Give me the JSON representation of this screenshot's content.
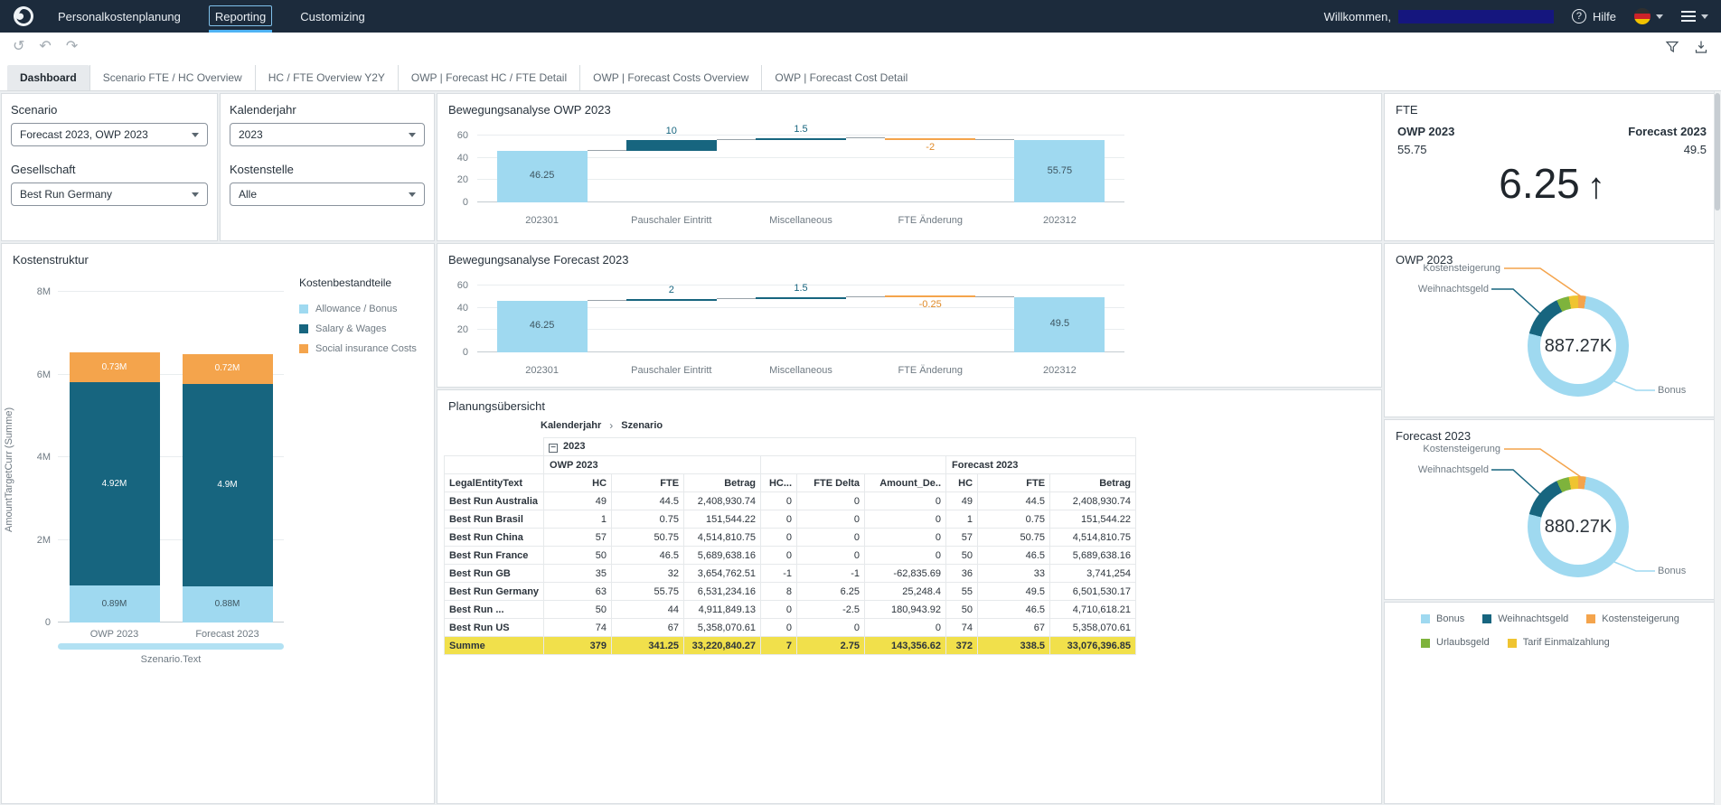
{
  "colors": {
    "light_blue": "#9FD9F0",
    "dark_blue": "#17657F",
    "orange": "#F4A44C",
    "green": "#7EB33C",
    "yellow": "#EFC431",
    "summe": "#F1E04B"
  },
  "navbar": {
    "items": [
      {
        "label": "Personalkostenplanung",
        "active": false
      },
      {
        "label": "Reporting",
        "active": true
      },
      {
        "label": "Customizing",
        "active": false
      }
    ],
    "welcome_label": "Willkommen,",
    "help_label": "Hilfe"
  },
  "toolbar": {
    "left_icons": [
      "reset",
      "undo",
      "redo"
    ],
    "right_icons": [
      "filter",
      "export"
    ]
  },
  "tabs": [
    {
      "label": "Dashboard",
      "active": true
    },
    {
      "label": "Scenario FTE / HC Overview",
      "active": false
    },
    {
      "label": "HC / FTE Overview Y2Y",
      "active": false
    },
    {
      "label": "OWP | Forecast HC / FTE Detail",
      "active": false
    },
    {
      "label": "OWP | Forecast Costs Overview",
      "active": false
    },
    {
      "label": "OWP | Forecast Cost Detail",
      "active": false
    }
  ],
  "filters": [
    {
      "label": "Scenario",
      "value": "Forecast 2023, OWP 2023"
    },
    {
      "label": "Kalenderjahr",
      "value": "2023"
    },
    {
      "label": "Gesellschaft",
      "value": "Best Run Germany"
    },
    {
      "label": "Kostenstelle",
      "value": "Alle"
    }
  ],
  "fte_card": {
    "title": "FTE",
    "left_label": "OWP 2023",
    "left_value": "55.75",
    "right_label": "Forecast 2023",
    "right_value": "49.5",
    "big_value": "6.25",
    "trend_arrow": "↑"
  },
  "chart_data": [
    {
      "type": "bar",
      "subtype": "waterfall",
      "title": "Bewegungsanalyse OWP 2023",
      "categories": [
        "202301",
        "Pauschaler Eintritt",
        "Miscellaneous",
        "FTE Änderung",
        "202312"
      ],
      "values": [
        46.25,
        10,
        1.5,
        -2,
        55.75
      ],
      "roles": [
        "total",
        "delta",
        "delta",
        "delta",
        "total"
      ],
      "ylim": [
        0,
        60
      ],
      "yticks": [
        0,
        20,
        40,
        60
      ],
      "grid": true,
      "legend_position": "none"
    },
    {
      "type": "bar",
      "subtype": "waterfall",
      "title": "Bewegungsanalyse Forecast 2023",
      "categories": [
        "202301",
        "Pauschaler Eintritt",
        "Miscellaneous",
        "FTE Änderung",
        "202312"
      ],
      "values": [
        46.25,
        2,
        1.5,
        -0.25,
        49.5
      ],
      "roles": [
        "total",
        "delta",
        "delta",
        "delta",
        "total"
      ],
      "ylim": [
        0,
        60
      ],
      "yticks": [
        0,
        20,
        40,
        60
      ],
      "grid": true,
      "legend_position": "none"
    },
    {
      "type": "bar",
      "subtype": "stacked",
      "title": "Kostenstruktur",
      "legend_title": "Kostenbestandteile",
      "categories": [
        "OWP 2023",
        "Forecast 2023"
      ],
      "series": [
        {
          "name": "Allowance / Bonus",
          "color": "light_blue",
          "values": [
            0.89,
            0.88
          ],
          "labels": [
            "0.89M",
            "0.88M"
          ]
        },
        {
          "name": "Salary & Wages",
          "color": "dark_blue",
          "values": [
            4.92,
            4.9
          ],
          "labels": [
            "4.92M",
            "4.9M"
          ]
        },
        {
          "name": "Social insurance Costs",
          "color": "orange",
          "values": [
            0.73,
            0.72
          ],
          "labels": [
            "0.73M",
            "0.72M"
          ]
        }
      ],
      "ylabel": "AmountTargetCurr (Summe)",
      "xlabel": "Szenario.Text",
      "unit": "M",
      "ylim": [
        0,
        8
      ],
      "yticks": [
        {
          "v": 0,
          "label": "0"
        },
        {
          "v": 2,
          "label": "2M"
        },
        {
          "v": 4,
          "label": "4M"
        },
        {
          "v": 6,
          "label": "6M"
        },
        {
          "v": 8,
          "label": "8M"
        }
      ],
      "grid": true,
      "legend_position": "right"
    },
    {
      "type": "pie",
      "title": "OWP 2023",
      "center_label": "887.27K",
      "slices": [
        {
          "name": "Kostensteigerung",
          "pct": 2.5,
          "color": "orange"
        },
        {
          "name": "Bonus",
          "pct": 76.5,
          "color": "light_blue"
        },
        {
          "name": "Weihnachtsgeld",
          "pct": 14,
          "color": "dark_blue"
        },
        {
          "name": "Urlaubsgeld",
          "pct": 4,
          "color": "green"
        },
        {
          "name": "Tarif Einmalzahlung",
          "pct": 3,
          "color": "yellow"
        }
      ],
      "callouts": [
        "Kostensteigerung",
        "Weihnachtsgeld",
        "Bonus"
      ]
    },
    {
      "type": "pie",
      "title": "Forecast 2023",
      "center_label": "880.27K",
      "slices": [
        {
          "name": "Kostensteigerung",
          "pct": 2.5,
          "color": "orange"
        },
        {
          "name": "Bonus",
          "pct": 76.5,
          "color": "light_blue"
        },
        {
          "name": "Weihnachtsgeld",
          "pct": 14,
          "color": "dark_blue"
        },
        {
          "name": "Urlaubsgeld",
          "pct": 4,
          "color": "green"
        },
        {
          "name": "Tarif Einmalzahlung",
          "pct": 3,
          "color": "yellow"
        }
      ],
      "callouts": [
        "Kostensteigerung",
        "Weihnachtsgeld",
        "Bonus"
      ]
    }
  ],
  "table": {
    "title": "Planungsübersicht",
    "drill_path": [
      "Kalenderjahr",
      "Szenario"
    ],
    "year_label": "2023",
    "group_headers": [
      "OWP 2023",
      "Forecast 2023"
    ],
    "columns": [
      "LegalEntityText",
      "HC",
      "FTE",
      "Betrag",
      "HC...",
      "FTE Delta",
      "Amount_De..",
      "HC",
      "FTE",
      "Betrag"
    ],
    "rows": [
      [
        "Best Run Australia",
        "49",
        "44.5",
        "2,408,930.74",
        "0",
        "0",
        "0",
        "49",
        "44.5",
        "2,408,930.74"
      ],
      [
        "Best Run Brasil",
        "1",
        "0.75",
        "151,544.22",
        "0",
        "0",
        "0",
        "1",
        "0.75",
        "151,544.22"
      ],
      [
        "Best Run China",
        "57",
        "50.75",
        "4,514,810.75",
        "0",
        "0",
        "0",
        "57",
        "50.75",
        "4,514,810.75"
      ],
      [
        "Best Run France",
        "50",
        "46.5",
        "5,689,638.16",
        "0",
        "0",
        "0",
        "50",
        "46.5",
        "5,689,638.16"
      ],
      [
        "Best Run GB",
        "35",
        "32",
        "3,654,762.51",
        "-1",
        "-1",
        "-62,835.69",
        "36",
        "33",
        "3,741,254"
      ],
      [
        "Best Run Germany",
        "63",
        "55.75",
        "6,531,234.16",
        "8",
        "6.25",
        "25,248.4",
        "55",
        "49.5",
        "6,501,530.17"
      ],
      [
        "Best Run ...",
        "50",
        "44",
        "4,911,849.13",
        "0",
        "-2.5",
        "180,943.92",
        "50",
        "46.5",
        "4,710,618.21"
      ],
      [
        "Best Run US",
        "74",
        "67",
        "5,358,070.61",
        "0",
        "0",
        "0",
        "74",
        "67",
        "5,358,070.61"
      ],
      [
        "Summe",
        "379",
        "341.25",
        "33,220,840.27",
        "7",
        "2.75",
        "143,356.62",
        "372",
        "338.5",
        "33,076,396.85"
      ]
    ]
  },
  "legend": {
    "items": [
      {
        "label": "Bonus",
        "color": "light_blue"
      },
      {
        "label": "Weihnachtsgeld",
        "color": "dark_blue"
      },
      {
        "label": "Kostensteigerung",
        "color": "orange"
      },
      {
        "label": "Urlaubsgeld",
        "color": "green"
      },
      {
        "label": "Tarif Einmalzahlung",
        "color": "yellow"
      }
    ]
  }
}
